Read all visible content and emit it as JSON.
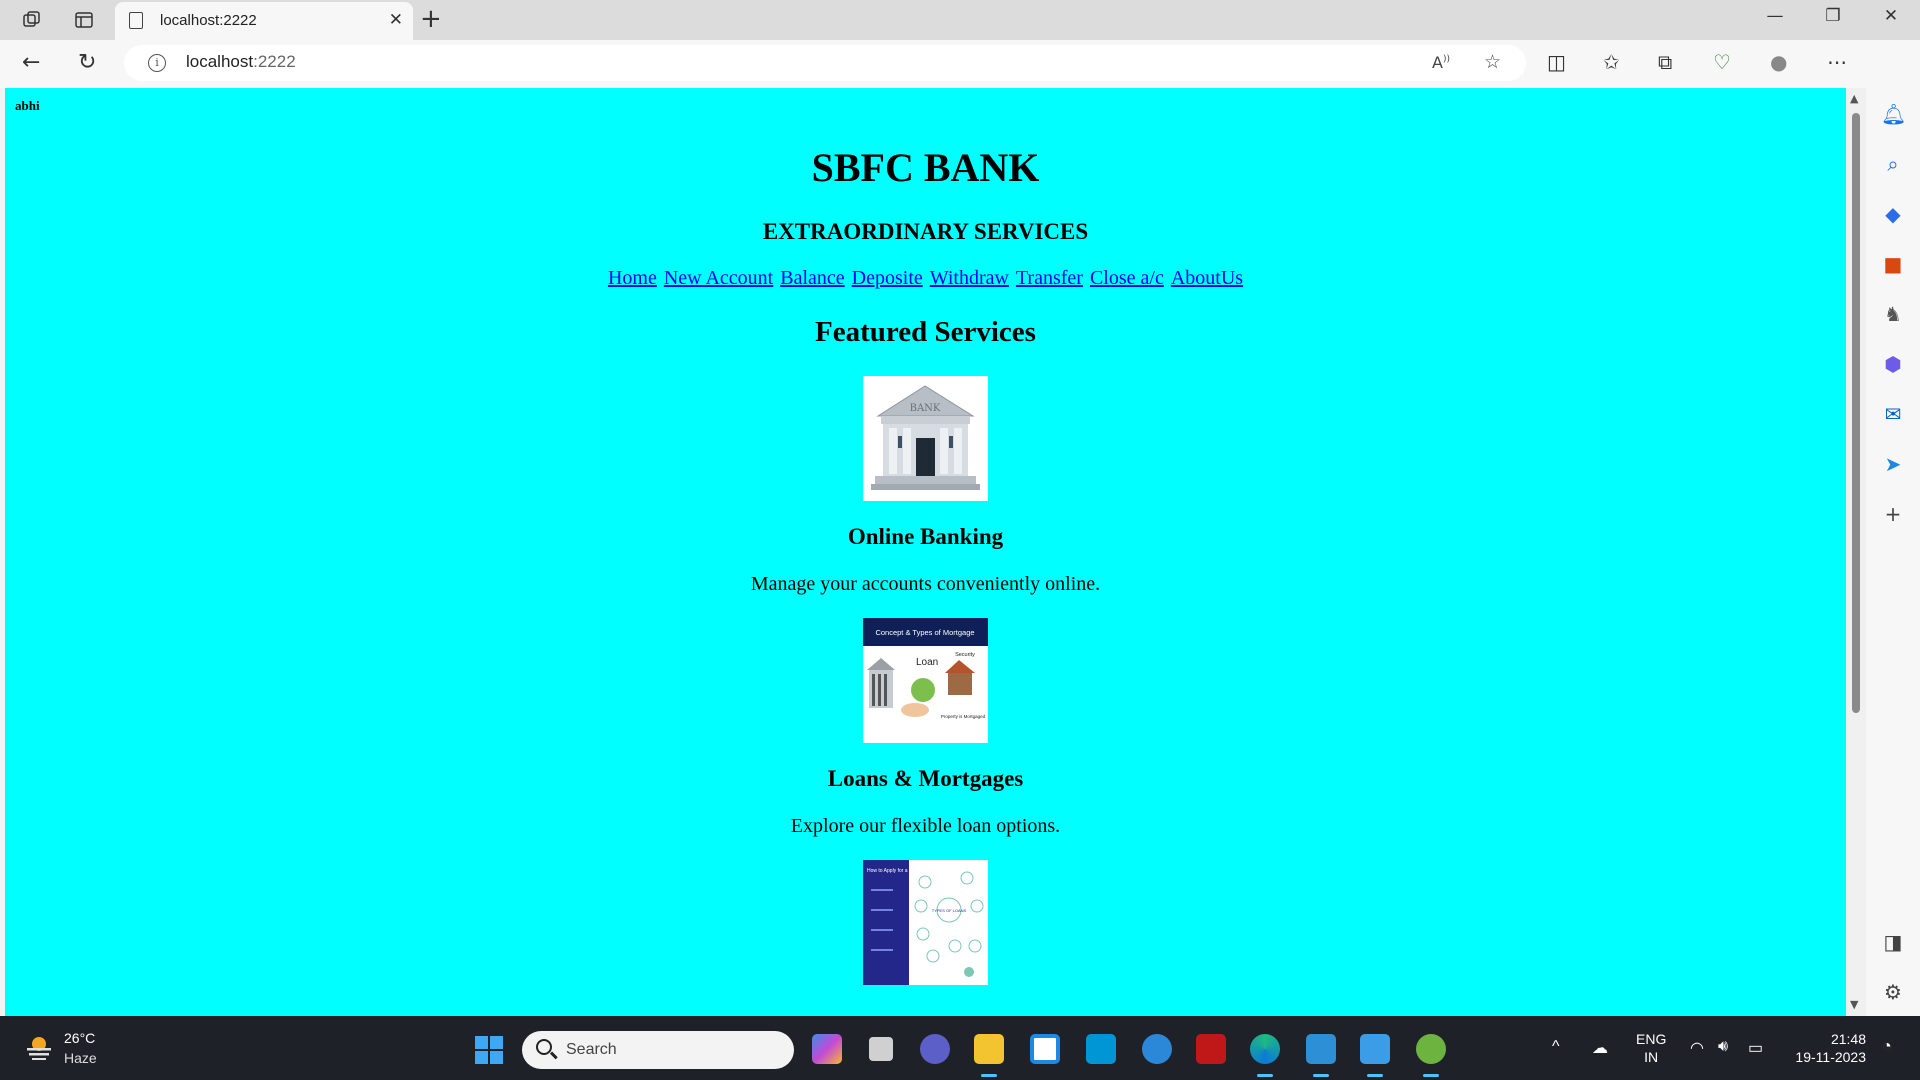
{
  "browser": {
    "tab_title": "localhost:2222",
    "url_host": "localhost",
    "url_port": ":2222",
    "new_tab_symbol": "+",
    "close_tab_symbol": "✕"
  },
  "page": {
    "user_label": "abhi",
    "bank_name": "SBFC BANK",
    "tagline": "EXTRAORDINARY SERVICES",
    "nav_links": [
      "Home",
      "New Account",
      "Balance",
      "Deposite",
      "Withdraw",
      "Transfer",
      "Close a/c",
      "AboutUs"
    ],
    "featured_heading": "Featured Services",
    "services": [
      {
        "title": "Online Banking",
        "description": "Manage your accounts conveniently online.",
        "image_text": "BANK"
      },
      {
        "title": "Loans & Mortgages",
        "description": "Explore our flexible loan options.",
        "image_text": [
          "Concept & Types of Mortgage",
          "Loan",
          "Security",
          "Property is Mortgaged"
        ]
      },
      {
        "title": "",
        "description": "",
        "image_text": [
          "How to Apply for a Loan?",
          "TYPES OF LOANS"
        ]
      }
    ],
    "background_color": "#00ffff",
    "link_color": "#0000ee"
  },
  "taskbar": {
    "weather_temp": "26°C",
    "weather_desc": "Haze",
    "search_placeholder": "Search",
    "lang_line1": "ENG",
    "lang_line2": "IN",
    "time": "21:48",
    "date": "19-11-2023",
    "apps": [
      "copilot-icon",
      "task-view-icon",
      "teams-icon",
      "file-explorer-icon",
      "store-icon",
      "myhp-icon",
      "help-icon",
      "mcafee-icon",
      "edge-icon",
      "vscode-icon",
      "paint-icon",
      "spring-icon"
    ]
  }
}
